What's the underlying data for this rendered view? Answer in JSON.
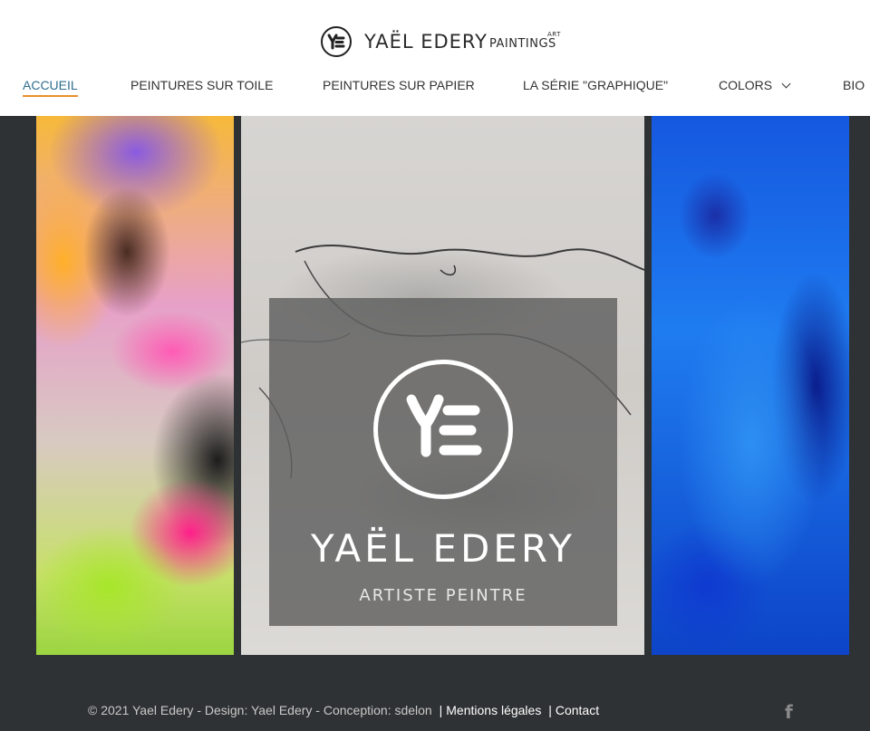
{
  "brand": {
    "name": "YAËL EDERY",
    "sub": "PAINTINGS",
    "art": "ART",
    "logo_icon": "ye-monogram-icon"
  },
  "nav": {
    "items": [
      {
        "label": "ACCUEIL",
        "active": true
      },
      {
        "label": "PEINTURES SUR TOILE"
      },
      {
        "label": "PEINTURES SUR PAPIER"
      },
      {
        "label": "LA SÉRIE \"GRAPHIQUE\""
      },
      {
        "label": "COLORS",
        "icon": "chevron-down-icon"
      },
      {
        "label": "BIO"
      }
    ]
  },
  "hero": {
    "title": "YAËL EDERY",
    "subtitle": "ARTISTE PEINTRE"
  },
  "footer": {
    "copyright": "© 2021 Yael Edery - Design: Yael Edery - Conception: sdelon",
    "separator": "|",
    "link_legal": "Mentions légales",
    "link_contact": "Contact",
    "social_icon": "facebook-icon"
  },
  "colors": {
    "header_bg": "#ffffff",
    "page_bg": "#2f3234",
    "nav_active": "#2e6e8e",
    "nav_underline": "#e8902a"
  }
}
